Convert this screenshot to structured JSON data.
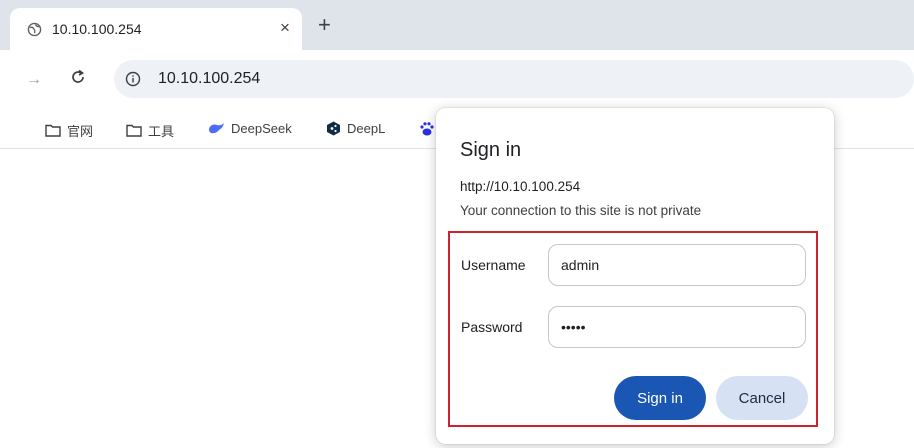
{
  "tab": {
    "title": "10.10.100.254",
    "close_glyph": "×",
    "new_tab_glyph": "+"
  },
  "toolbar": {
    "forward_glyph": "→",
    "url": "10.10.100.254"
  },
  "bookmarks": [
    {
      "label": "官网",
      "icon": "folder-icon"
    },
    {
      "label": "工具",
      "icon": "folder-icon"
    },
    {
      "label": "DeepSeek",
      "icon": "deepseek-icon"
    },
    {
      "label": "DeepL",
      "icon": "deepl-icon"
    }
  ],
  "dialog": {
    "title": "Sign in",
    "origin": "http://10.10.100.254",
    "warning": "Your connection to this site is not private",
    "username_label": "Username",
    "username_value": "admin",
    "password_label": "Password",
    "password_value": "•••••",
    "signin_label": "Sign in",
    "cancel_label": "Cancel"
  },
  "colors": {
    "accent": "#1a56b4",
    "highlight": "#d0222e",
    "cancel_bg": "#d6e2f4"
  }
}
